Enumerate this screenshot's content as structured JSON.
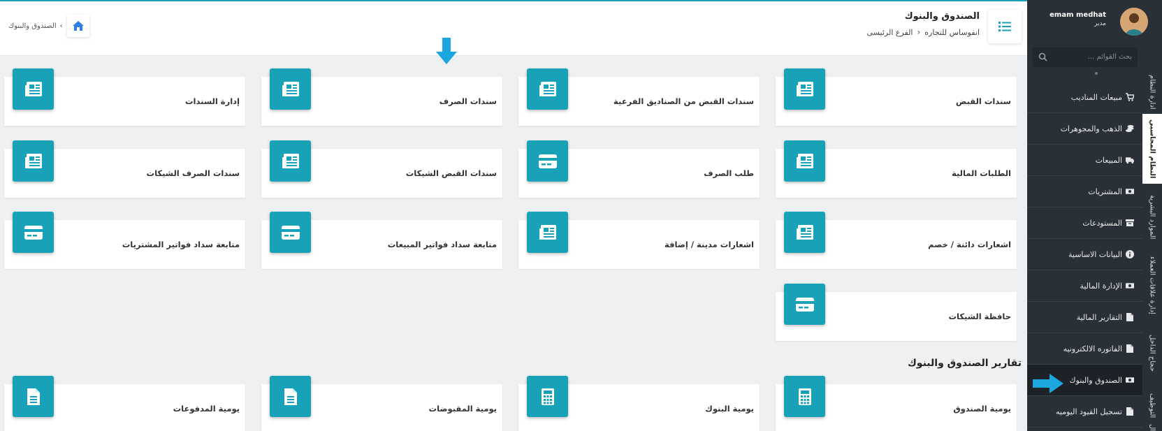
{
  "header": {
    "title": "الصندوق والبنوك",
    "breadcrumb": [
      "انفوساس للتجاره",
      "الفرع الرئيسى"
    ],
    "left_breadcrumb": "الصندوق والبنوك"
  },
  "cards": [
    {
      "label": "سندات القبض",
      "icon": "receipt-icon"
    },
    {
      "label": "سندات القبض من الصناديق الفرعية",
      "icon": "receipt-icon"
    },
    {
      "label": "سندات الصرف",
      "icon": "receipt-icon"
    },
    {
      "label": "إدارة السندات",
      "icon": "receipt-icon"
    },
    {
      "label": "الطلبات المالية",
      "icon": "receipt-icon"
    },
    {
      "label": "طلب الصرف",
      "icon": "credit-card-icon"
    },
    {
      "label": "سندات القبض الشيكات",
      "icon": "receipt-icon"
    },
    {
      "label": "سندات الصرف الشيكات",
      "icon": "receipt-icon"
    },
    {
      "label": "اشعارات دائنة / خصم",
      "icon": "receipt-icon"
    },
    {
      "label": "اشعارات مدينة / إضافة",
      "icon": "receipt-icon"
    },
    {
      "label": "متابعة سداد فواتير المبيعات",
      "icon": "credit-card-icon"
    },
    {
      "label": "متابعة سداد فواتير المشتريات",
      "icon": "credit-card-icon"
    },
    {
      "label": "حافظة الشيكات",
      "icon": "credit-card-icon"
    }
  ],
  "reports": {
    "title": "تقارير الصندوق والبنوك",
    "items": [
      {
        "label": "يومية الصندوق",
        "icon": "calculator-icon"
      },
      {
        "label": "يومية البنوك",
        "icon": "calculator-icon"
      },
      {
        "label": "يومية المقبوضات",
        "icon": "document-icon"
      },
      {
        "label": "يومية المدفوعات",
        "icon": "document-icon"
      }
    ]
  },
  "sidebar": {
    "user_name": "emam medhat",
    "user_role": "مدير",
    "search_placeholder": "بحث القوائم ...",
    "items": [
      {
        "label": "مبيعات المناديب",
        "icon": "cart-icon",
        "active": false
      },
      {
        "label": "الذهب والمجوهرات",
        "icon": "coins-icon",
        "active": false
      },
      {
        "label": "المبيعات",
        "icon": "truck-icon",
        "active": false
      },
      {
        "label": "المشتريات",
        "icon": "money-icon",
        "active": false
      },
      {
        "label": "المستودعات",
        "icon": "archive-icon",
        "active": false
      },
      {
        "label": "البيانات الاساسية",
        "icon": "info-icon",
        "active": false
      },
      {
        "label": "الإدارة المالية",
        "icon": "money-icon",
        "active": false
      },
      {
        "label": "التقارير المالية",
        "icon": "file-icon",
        "active": false
      },
      {
        "label": "الفاتوره الالكترونيه",
        "icon": "file-icon",
        "active": false
      },
      {
        "label": "الصندوق والبنوك",
        "icon": "money-icon",
        "active": true
      },
      {
        "label": "تسجيل القيود اليوميه",
        "icon": "file-icon",
        "active": false
      }
    ],
    "vertical_tabs": [
      {
        "label": "ادارة النظام",
        "active": false
      },
      {
        "label": "النظام المحاسبي",
        "active": true
      },
      {
        "label": "الموارد البشرية",
        "active": false
      },
      {
        "label": "إدارة علاقات العملاء",
        "active": false
      },
      {
        "label": "حجاج الداخل",
        "active": false
      },
      {
        "label": "التوظيف",
        "active": false
      },
      {
        "label": "ال",
        "active": false
      }
    ]
  },
  "colors": {
    "accent": "#17a2b8",
    "sidebar_bg": "#2a3037",
    "highlight_arrow": "#1ba6e0"
  }
}
